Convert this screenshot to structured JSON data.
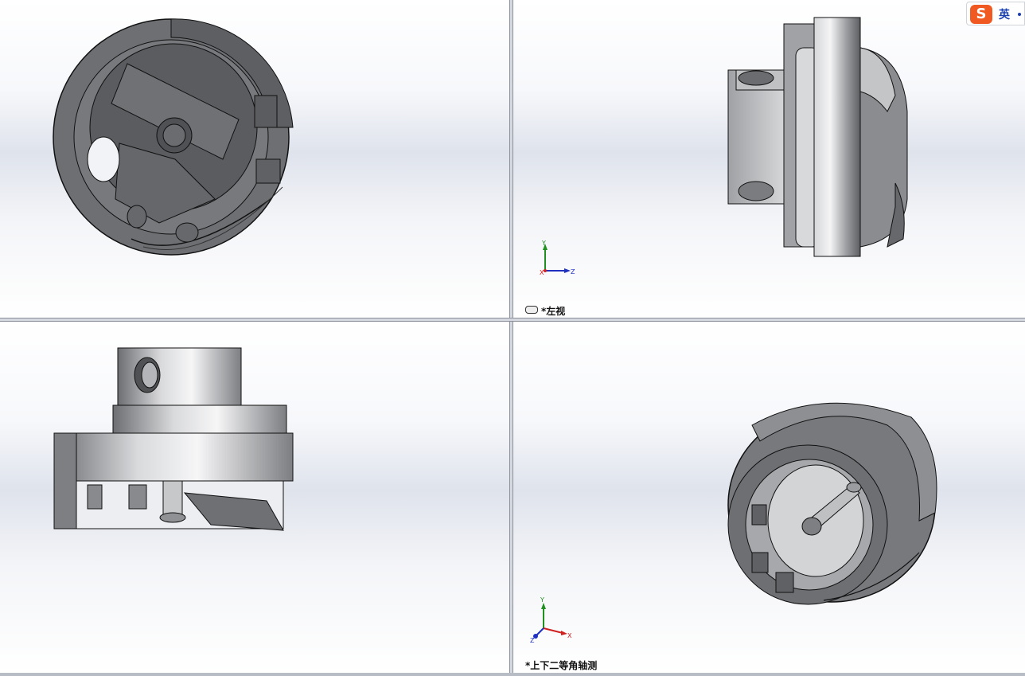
{
  "viewports": {
    "top_left": {
      "name": "front-view"
    },
    "top_right": {
      "name": "left-view",
      "label": "*左视",
      "triad_axes": [
        "Y",
        "X",
        "Z"
      ]
    },
    "bottom_left": {
      "name": "top-view"
    },
    "bottom_right": {
      "name": "isometric-view",
      "label": "*上下二等角轴测",
      "triad_axes": [
        "Y",
        "Z",
        "X"
      ]
    }
  },
  "ime": {
    "logo": "S",
    "mode": "英",
    "icon": "sogou-ime-icon"
  },
  "colors": {
    "part_dark": "#5f6165",
    "part_mid": "#8c8e92",
    "part_light": "#c9cacc",
    "edge": "#1a1a1a",
    "axis_x": "#d02020",
    "axis_y": "#209020",
    "axis_z": "#2030c0"
  }
}
